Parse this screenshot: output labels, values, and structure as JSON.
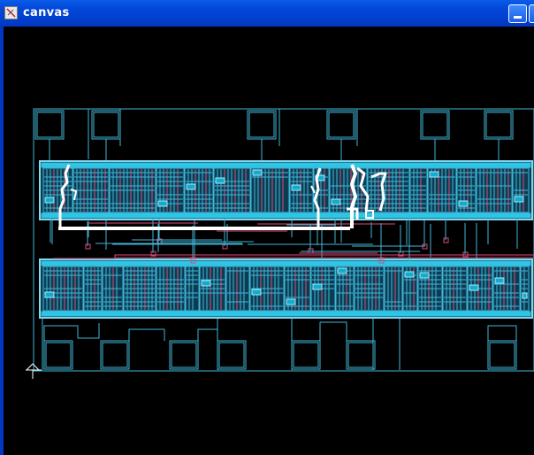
{
  "window": {
    "title": "canvas",
    "buttons": [
      "minimize",
      "maximize"
    ]
  },
  "icons": {
    "app": "layout-editor-icon",
    "origin": "origin-marker-icon"
  },
  "colors": {
    "background": "#000000",
    "titlebar": "#0347d8",
    "cell_outline": "#3fb7d9",
    "metal_fill": "#29c8e6",
    "poly": "#d84c7a",
    "highlight_net": "#ffffff"
  }
}
